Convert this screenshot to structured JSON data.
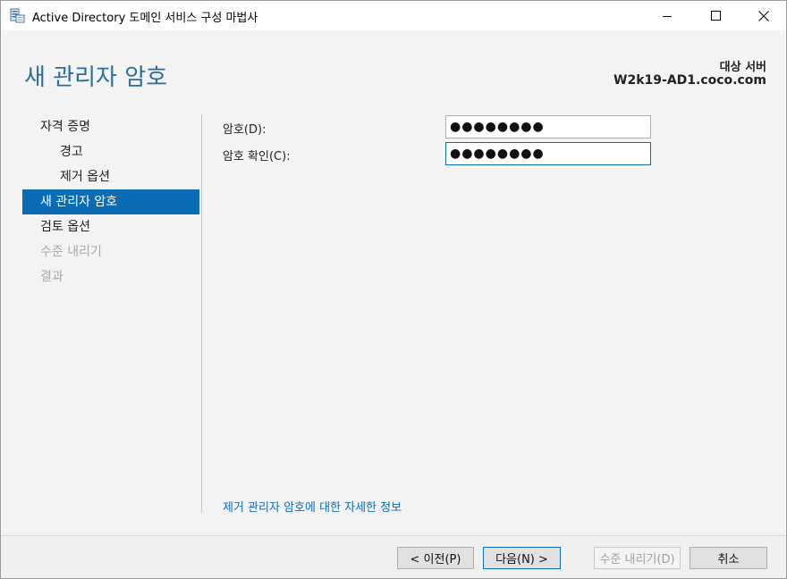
{
  "window": {
    "title": "Active Directory 도메인 서비스 구성 마법사",
    "app_icon": "server-wizard-icon",
    "controls": [
      "minimize-icon",
      "maximize-icon",
      "close-icon"
    ]
  },
  "header": {
    "page_title": "새 관리자 암호",
    "target_label": "대상 서버",
    "target_value": "W2k19-AD1.coco.com"
  },
  "nav": {
    "items": [
      {
        "label": "자격 증명",
        "state": "normal",
        "level": 0
      },
      {
        "label": "경고",
        "state": "normal",
        "level": 1
      },
      {
        "label": "제거 옵션",
        "state": "normal",
        "level": 1
      },
      {
        "label": "새 관리자 암호",
        "state": "active",
        "level": 0
      },
      {
        "label": "검토 옵션",
        "state": "normal",
        "level": 0
      },
      {
        "label": "수준 내리기",
        "state": "disabled",
        "level": 0
      },
      {
        "label": "결과",
        "state": "disabled",
        "level": 0
      }
    ]
  },
  "form": {
    "password_label": "암호(D):",
    "password_value": "●●●●●●●●",
    "confirm_label": "암호 확인(C):",
    "confirm_value": "●●●●●●●●"
  },
  "help_link": "제거 관리자 암호에 대한 자세한 정보",
  "footer": {
    "prev_label": "< 이전(P)",
    "next_label": "다음(N) >",
    "demote_label": "수준 내리기(D)",
    "cancel_label": "취소"
  },
  "colors": {
    "accent": "#0a6cb5",
    "title": "#2a6f9c",
    "panel_bg": "#f3f3f3",
    "disabled_text": "#a8a8a8"
  }
}
